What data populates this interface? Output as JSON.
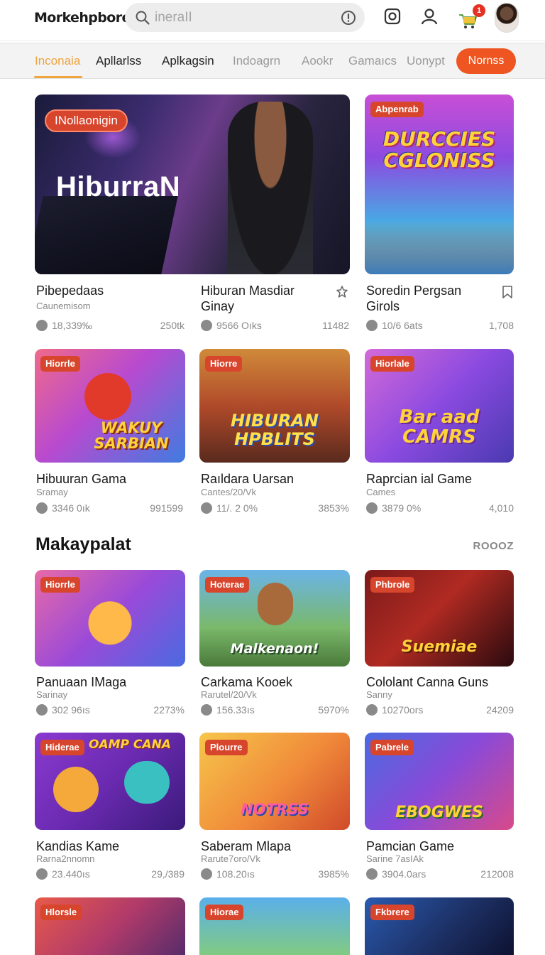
{
  "app": {
    "logo": "Morkehpbore"
  },
  "search": {
    "placeholder": "ineraII"
  },
  "header": {
    "cart_count": "1"
  },
  "tabs": [
    {
      "label": "Inconaia"
    },
    {
      "label": "Apllarlss"
    },
    {
      "label": "Aplkagsin"
    },
    {
      "label": "Indoagrn"
    },
    {
      "label": "Aookr"
    },
    {
      "label": "Gamaıcs"
    },
    {
      "label": "Uonypt"
    }
  ],
  "tab_cta": "Nornss",
  "featured": {
    "badge": "INollaonigin",
    "art_title": "HiburraN",
    "cards": [
      {
        "title": "Pibepedaas",
        "subtitle": "Caunemisom",
        "stat_left": "18,339‰",
        "stat_right": "250tk"
      },
      {
        "title": "Hiburan Masdiar Ginay",
        "subtitle": "",
        "stat_left": "9566 Oıks",
        "stat_right": "11482"
      },
      {
        "title": "Soredin Pergsan Girols",
        "subtitle": "",
        "stat_left": "10/6 6ats",
        "stat_right": "1,708"
      }
    ],
    "side_card": {
      "badge": "Abpenrab",
      "art_title": "DURCCIES CGLONISS"
    }
  },
  "grid_row1": [
    {
      "badge": "Hiorrle",
      "art_title": "WAKUY SARBIAN",
      "title": "Hibuuran Gama",
      "subtitle": "Sramay",
      "stat_left": "3346 0ık",
      "stat_right": "991599"
    },
    {
      "badge": "Hiorre",
      "art_title": "HIBURAN HPBLITS",
      "title": "Raıldara Uarsan",
      "subtitle": "Cantes/20/Vk",
      "stat_left": "11/. 2 0%",
      "stat_right": "3853%"
    },
    {
      "badge": "Hiorlale",
      "art_title": "Bar aad CAMRS",
      "title": "Raprcian ial Game",
      "subtitle": "Cames",
      "stat_left": "3879 0%",
      "stat_right": "4,010"
    }
  ],
  "section": {
    "title": "Makaypalat",
    "link": "ROOOZ"
  },
  "grid_row2": [
    {
      "badge": "Hiorrle",
      "art_title": "",
      "title": "Panuaan IMaga",
      "subtitle": "Sarinay",
      "stat_left": "302 96ıs",
      "stat_right": "2273%"
    },
    {
      "badge": "Hoterae",
      "art_title": "Malkenaon!",
      "title": "Carkama Kooek",
      "subtitle": "Rarutel/20/Vk",
      "stat_left": "156.33ıs",
      "stat_right": "5970%"
    },
    {
      "badge": "Phbrole",
      "art_title": "Suemiae",
      "title": "Cololant Canna Guns",
      "subtitle": "Sanny",
      "stat_left": "10270ors",
      "stat_right": "24209"
    }
  ],
  "grid_row3": [
    {
      "badge": "Hiderae",
      "art_title": "OAMP CANA",
      "title": "Kandias Kame",
      "subtitle": "Rarna2nnomn",
      "stat_left": "23.440ıs",
      "stat_right": "29,/389"
    },
    {
      "badge": "Plourre",
      "art_title": "NOTRSS",
      "title": "Saberam Mlapa",
      "subtitle": "Rarute7oro/Vk",
      "stat_left": "108.20ıs",
      "stat_right": "3985%"
    },
    {
      "badge": "Pabrele",
      "art_title": "EBOGWES",
      "title": "Pamcian Game",
      "subtitle": "Sarine 7asIAk",
      "stat_left": "3904.0ars",
      "stat_right": "212008"
    }
  ],
  "grid_row4": [
    {
      "badge": "Hlorsle"
    },
    {
      "badge": "Hiorae"
    },
    {
      "badge": "Fkbrere"
    }
  ],
  "colors": {
    "accent": "#f0a63c",
    "cta": "#ee5520",
    "badge": "#d8452d"
  },
  "icons": [
    "search-icon",
    "info-icon",
    "instagram-icon",
    "user-icon",
    "cart-icon",
    "bookmark-icon",
    "download-icon"
  ]
}
